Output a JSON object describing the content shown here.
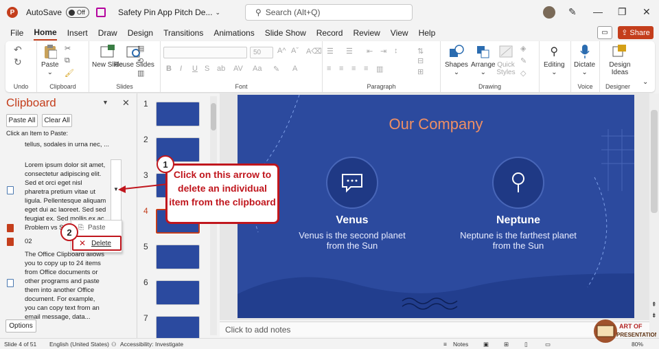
{
  "titlebar": {
    "autosave_label": "AutoSave",
    "autosave_state": "Off",
    "doc_title": "Safety Pin App Pitch De...",
    "search_placeholder": "Search (Alt+Q)"
  },
  "menu": [
    "File",
    "Home",
    "Insert",
    "Draw",
    "Design",
    "Transitions",
    "Animations",
    "Slide Show",
    "Record",
    "Review",
    "View",
    "Help"
  ],
  "share_label": "Share",
  "ribbon": {
    "undo_label": "Undo",
    "clipboard": {
      "paste": "Paste",
      "group": "Clipboard"
    },
    "slides": {
      "new_slide": "New Slide",
      "reuse_slides": "Reuse Slides",
      "group": "Slides"
    },
    "font": {
      "size": "50",
      "group": "Font"
    },
    "paragraph": {
      "group": "Paragraph"
    },
    "drawing": {
      "shapes": "Shapes",
      "arrange": "Arrange",
      "quick_styles": "Quick Styles",
      "group": "Drawing"
    },
    "editing": {
      "label": "Editing"
    },
    "voice": {
      "dictate": "Dictate",
      "group": "Voice"
    },
    "designer": {
      "design_ideas": "Design Ideas",
      "group": "Designer"
    }
  },
  "clipboard_pane": {
    "title": "Clipboard",
    "paste_all": "Paste All",
    "clear_all": "Clear All",
    "hint": "Click an Item to Paste:",
    "item_top": "tellus, sodales in urna nec, ...",
    "item_lorem": "Lorem ipsum dolor sit amet, consectetur adipiscing elit. Sed et orci eget nisl pharetra pretium vitae ut ligula. Pellentesque aliquam eget dui ac laoreet. Sed sed feugiat ex. Sed mollis ex ac ...",
    "item_problem": "Problem vs S",
    "item_02": "02",
    "item_office": "The Office Clipboard allows you to copy up to 24 items from Office documents or other programs and paste them into another Office document. For example, you can copy text from an email message, data...",
    "options": "Options",
    "ctx_paste": "Paste",
    "ctx_delete": "Delete"
  },
  "thumbnails": [
    {
      "num": "1"
    },
    {
      "num": "2"
    },
    {
      "num": "3"
    },
    {
      "num": "4"
    },
    {
      "num": "5"
    },
    {
      "num": "6"
    },
    {
      "num": "7"
    }
  ],
  "slide": {
    "title": "Our Company",
    "left_name": "Venus",
    "left_desc": "Venus is the second planet from the Sun",
    "right_name": "Neptune",
    "right_desc": "Neptune is the farthest planet from the Sun"
  },
  "callout": {
    "badge1": "1",
    "text": "Click on this arrow to delete an individual item from the clipboard",
    "badge2": "2"
  },
  "notes_placeholder": "Click to add notes",
  "status": {
    "slide_count": "Slide 4 of 51",
    "language": "English (United States)",
    "accessibility": "Accessibility: Investigate",
    "notes": "Notes",
    "zoom": "80%"
  },
  "logo": {
    "line1": "ART OF",
    "line2": "PRESENTATIONS"
  },
  "colors": {
    "accent": "#c43e1c",
    "annotation": "#c0161d",
    "slide_bg": "#2c4a9e",
    "slide_title": "#ef8f64"
  }
}
